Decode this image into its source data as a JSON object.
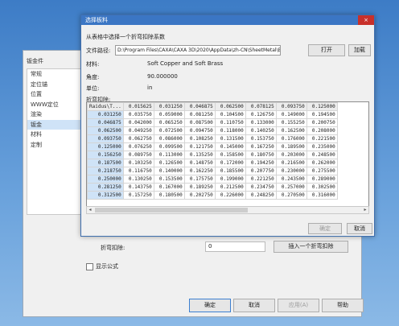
{
  "background_window": {
    "title": "钣金件",
    "sidebar": [
      "常规",
      "定位锚",
      "位置",
      "WWW定位",
      "渲染",
      "钣金",
      "材料",
      "定制"
    ],
    "selected_index": 5,
    "bend_table_label": "折弯扣除:",
    "bend_table_value": "0",
    "insert_button": "插入一个折弯扣除",
    "show_formula": "显示公式",
    "ok": "确定",
    "cancel": "取消",
    "apply": "应用(A)",
    "help": "帮助"
  },
  "dialog": {
    "title": "选择板料",
    "close": "×",
    "prompt": "从表格中选择一个折弯扣除系数",
    "path_label": "文件路径:",
    "path_value": "D:\\Program Files\\CAXA\\CAXA 3D\\2020\\AppData\\zh-CN\\SheetMetal\\BendDeductio",
    "open_button": "打开",
    "load_button": "加载",
    "material_label": "材料:",
    "material_value": "Soft Copper and Soft Brass",
    "angle_label": "角度:",
    "angle_value": "90.000000",
    "unit_label": "单位:",
    "unit_value": "in",
    "table_label": "折弯扣除:",
    "ok_button": "确定",
    "cancel_button": "取消"
  },
  "table": {
    "corner": "Raidus\\T...",
    "headers": [
      "0.015625",
      "0.031250",
      "0.046875",
      "0.062500",
      "0.078125",
      "0.093750",
      "0.125000"
    ],
    "rows": [
      [
        "0.031250",
        "0.035750",
        "0.059000",
        "0.081250",
        "0.104500",
        "0.126750",
        "0.149000",
        "0.194500"
      ],
      [
        "0.046875",
        "0.042000",
        "0.065250",
        "0.087500",
        "0.110750",
        "0.133000",
        "0.155250",
        "0.200750"
      ],
      [
        "0.062500",
        "0.049250",
        "0.072500",
        "0.094750",
        "0.118000",
        "0.140250",
        "0.162500",
        "0.208000"
      ],
      [
        "0.093750",
        "0.062750",
        "0.086000",
        "0.108250",
        "0.131500",
        "0.153750",
        "0.176000",
        "0.221500"
      ],
      [
        "0.125000",
        "0.076250",
        "0.099500",
        "0.121750",
        "0.145000",
        "0.167250",
        "0.189500",
        "0.235000"
      ],
      [
        "0.156250",
        "0.089750",
        "0.113000",
        "0.135250",
        "0.158500",
        "0.180750",
        "0.203000",
        "0.248500"
      ],
      [
        "0.187500",
        "0.103250",
        "0.126500",
        "0.148750",
        "0.172000",
        "0.194250",
        "0.216500",
        "0.262000"
      ],
      [
        "0.218750",
        "0.116750",
        "0.140000",
        "0.162250",
        "0.185500",
        "0.207750",
        "0.230000",
        "0.275500"
      ],
      [
        "0.250000",
        "0.130250",
        "0.153500",
        "0.175750",
        "0.199000",
        "0.221250",
        "0.243500",
        "0.289000"
      ],
      [
        "0.281250",
        "0.143750",
        "0.167000",
        "0.189250",
        "0.212500",
        "0.234750",
        "0.257000",
        "0.302500"
      ],
      [
        "0.312500",
        "0.157250",
        "0.180500",
        "0.202750",
        "0.226000",
        "0.248250",
        "0.270500",
        "0.316000"
      ]
    ]
  }
}
